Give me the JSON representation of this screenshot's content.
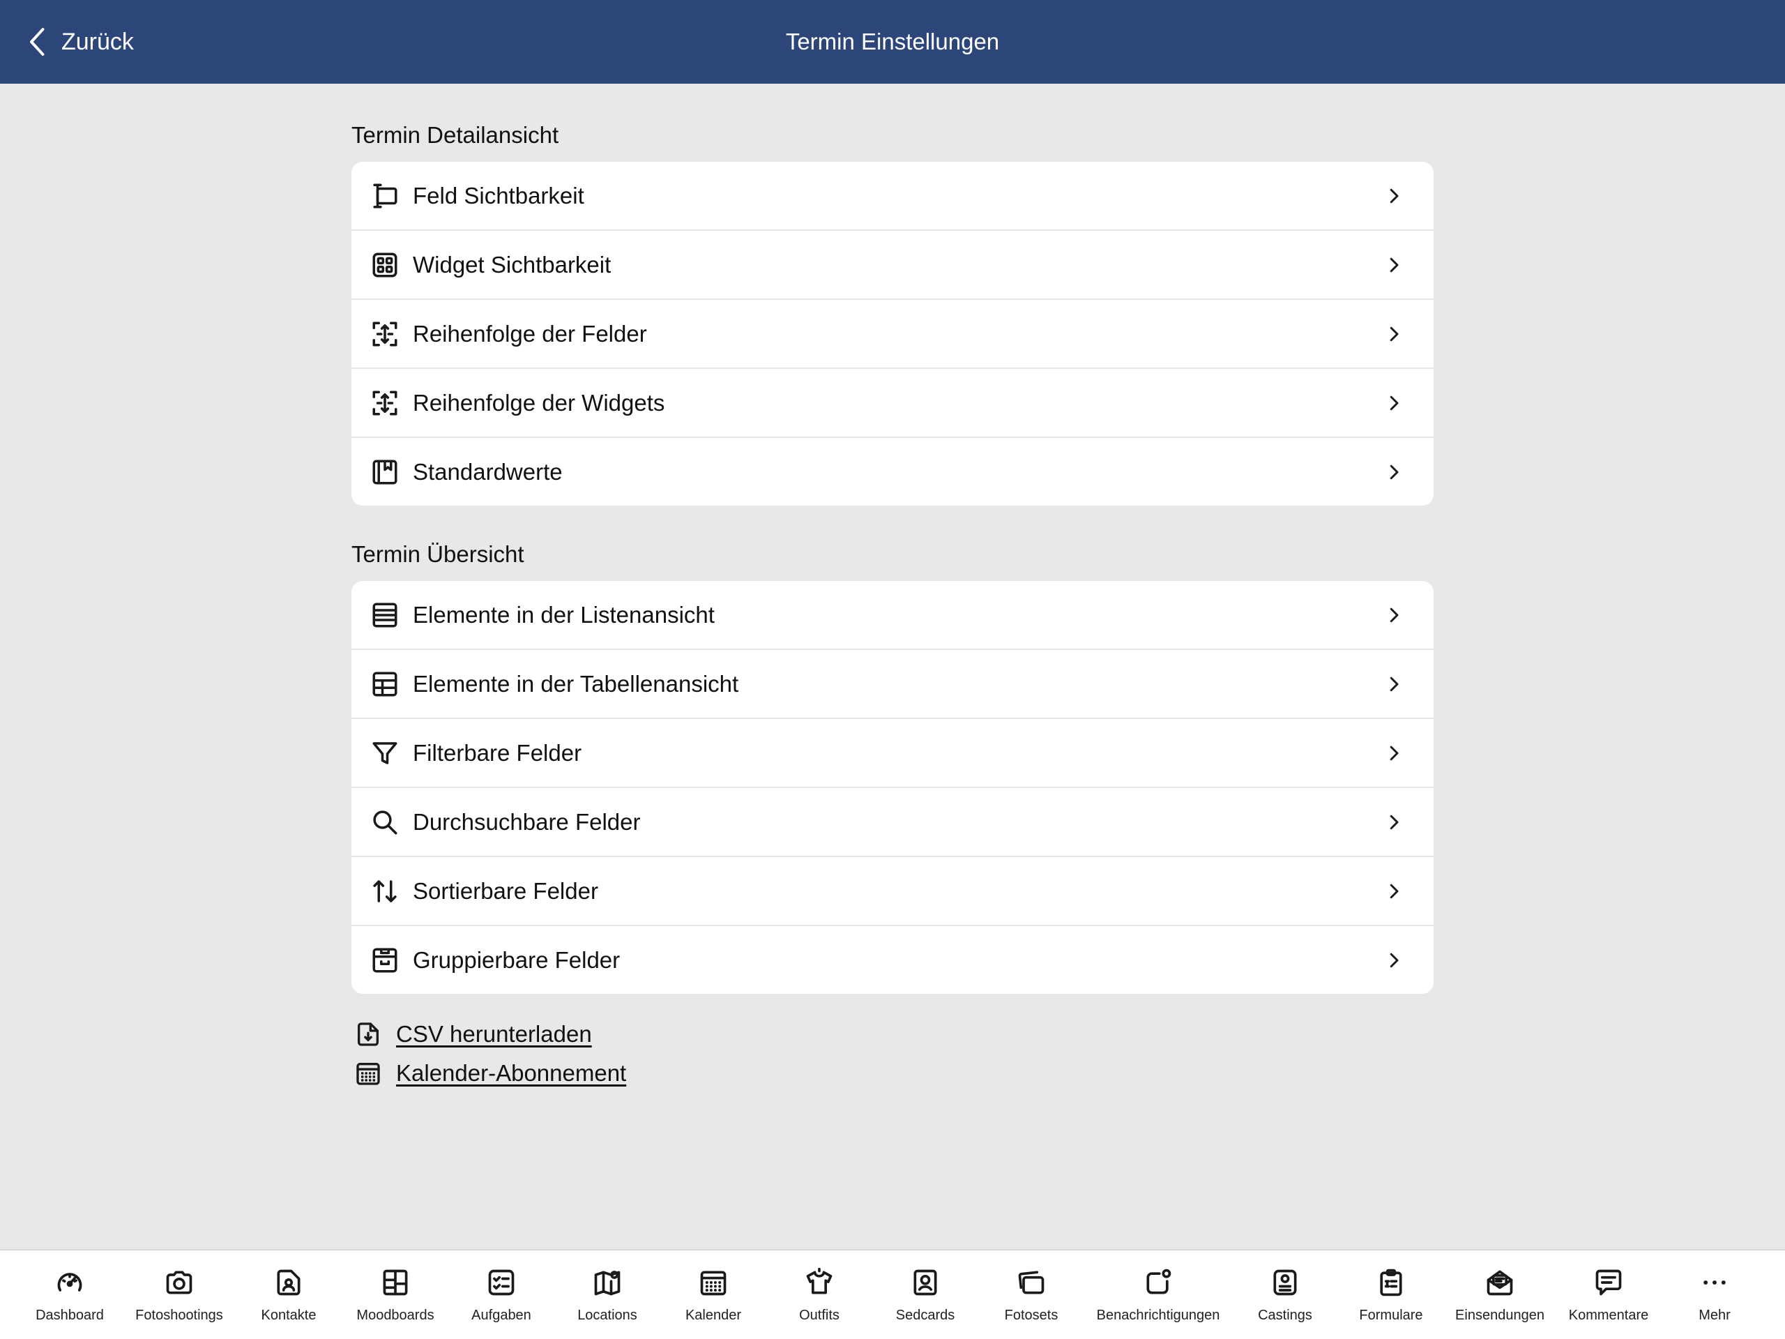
{
  "header": {
    "back_label": "Zurück",
    "title": "Termin Einstellungen"
  },
  "sections": [
    {
      "title": "Termin Detailansicht",
      "items": [
        {
          "label": "Feld Sichtbarkeit",
          "icon": "text-field-icon"
        },
        {
          "label": "Widget Sichtbarkeit",
          "icon": "widgets-icon"
        },
        {
          "label": "Reihenfolge der Felder",
          "icon": "reorder-icon"
        },
        {
          "label": "Reihenfolge der Widgets",
          "icon": "reorder-icon"
        },
        {
          "label": "Standardwerte",
          "icon": "bookmark-folder-icon"
        }
      ]
    },
    {
      "title": "Termin Übersicht",
      "items": [
        {
          "label": "Elemente in der Listenansicht",
          "icon": "list-icon"
        },
        {
          "label": "Elemente in der Tabellenansicht",
          "icon": "table-icon"
        },
        {
          "label": "Filterbare Felder",
          "icon": "filter-icon"
        },
        {
          "label": "Durchsuchbare Felder",
          "icon": "search-icon"
        },
        {
          "label": "Sortierbare Felder",
          "icon": "sort-icon"
        },
        {
          "label": "Gruppierbare Felder",
          "icon": "group-box-icon"
        }
      ]
    }
  ],
  "links": [
    {
      "label": "CSV herunterladen",
      "icon": "file-download-icon"
    },
    {
      "label": "Kalender-Abonnement",
      "icon": "calendar-icon"
    }
  ],
  "tabbar": [
    {
      "label": "Dashboard",
      "icon": "gauge-icon"
    },
    {
      "label": "Fotoshootings",
      "icon": "camera-icon"
    },
    {
      "label": "Kontakte",
      "icon": "contact-icon"
    },
    {
      "label": "Moodboards",
      "icon": "moodboard-icon"
    },
    {
      "label": "Aufgaben",
      "icon": "tasks-icon"
    },
    {
      "label": "Locations",
      "icon": "map-icon"
    },
    {
      "label": "Kalender",
      "icon": "calendar-icon"
    },
    {
      "label": "Outfits",
      "icon": "shirt-icon"
    },
    {
      "label": "Sedcards",
      "icon": "sedcard-icon"
    },
    {
      "label": "Fotosets",
      "icon": "photo-stack-icon"
    },
    {
      "label": "Benachrichtigungen",
      "icon": "notification-icon"
    },
    {
      "label": "Castings",
      "icon": "casting-icon"
    },
    {
      "label": "Formulare",
      "icon": "clipboard-icon"
    },
    {
      "label": "Einsendungen",
      "icon": "envelope-icon"
    },
    {
      "label": "Kommentare",
      "icon": "comment-icon"
    },
    {
      "label": "Mehr",
      "icon": "more-icon"
    }
  ],
  "colors": {
    "header_bg": "#2c4679",
    "page_bg": "#e8e8e8",
    "card_bg": "#ffffff"
  }
}
